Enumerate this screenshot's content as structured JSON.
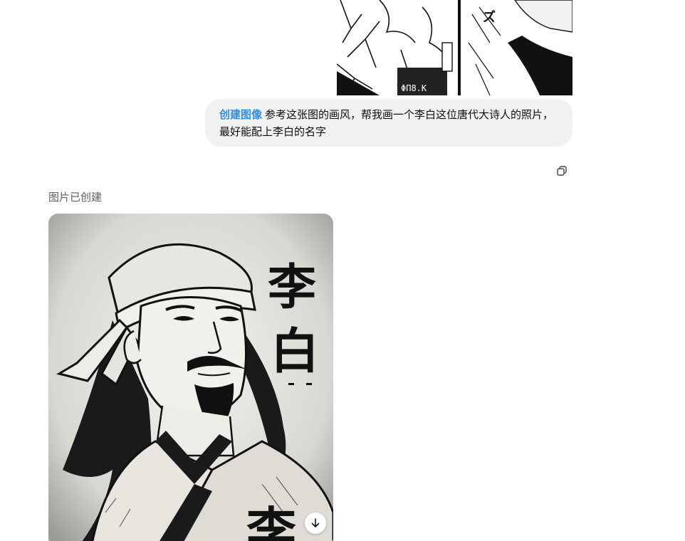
{
  "user_message": {
    "tool_tag": "创建图像",
    "text": "参考这张图的画风，帮我画一个李白这位唐代大诗人的照片，最好能配上李白的名字"
  },
  "icons": {
    "copy": "copy-icon",
    "download": "download-icon"
  },
  "assistant": {
    "status_label": "图片已创建",
    "image_caption_chars": [
      "李",
      "白",
      "李"
    ]
  },
  "colors": {
    "tool_tag": "#2f8ee6",
    "bubble_bg": "#f1f1f1",
    "status_text": "#5d5d5d"
  }
}
